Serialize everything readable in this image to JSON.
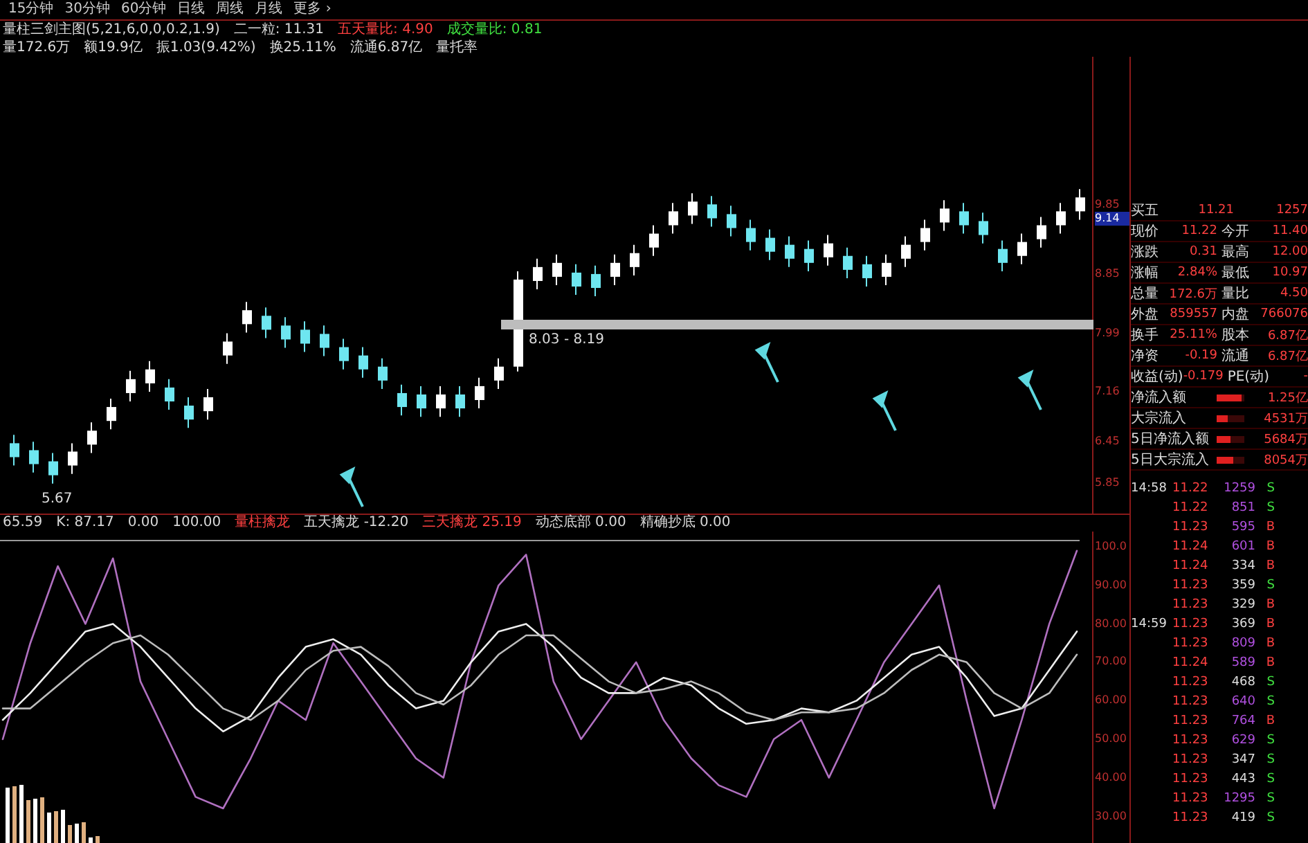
{
  "period_tabs": [
    {
      "label": "15分钟",
      "selected": false
    },
    {
      "label": "30分钟",
      "selected": false
    },
    {
      "label": "60分钟",
      "selected": false
    },
    {
      "label": "日线",
      "selected": false
    },
    {
      "label": "周线",
      "selected": false
    },
    {
      "label": "月线",
      "selected": false
    },
    {
      "label": "更多 ›",
      "selected": false
    }
  ],
  "indicator_header": [
    {
      "text": "量柱三剑主图(5,21,6,0,0,0.2,1.9)",
      "kind": "plain"
    },
    {
      "text": "二一粒: 11.31",
      "kind": "plain"
    },
    {
      "text": "五天量比: 4.90",
      "kind": "red"
    },
    {
      "text": "成交量比: 0.81",
      "kind": "green"
    }
  ],
  "quote_header": [
    "量172.6万",
    "额19.9亿",
    "振1.03(9.42%)",
    "换25.11%",
    "流通6.87亿",
    "量托率"
  ],
  "main_chart": {
    "low_label": "5.67",
    "band_label": "8.03 - 8.19",
    "price_tag": "9.14",
    "chart_data": {
      "type": "candlestick",
      "ylim": [
        5.41,
        11.97
      ],
      "yticks": [
        9.85,
        8.85,
        7.99,
        7.16,
        6.45,
        5.85
      ],
      "ohlc": [
        [
          6.42,
          6.54,
          6.1,
          6.22
        ],
        [
          6.32,
          6.44,
          6.0,
          6.12
        ],
        [
          6.16,
          6.28,
          5.84,
          5.96
        ],
        [
          6.1,
          6.42,
          5.98,
          6.3
        ],
        [
          6.4,
          6.72,
          6.28,
          6.6
        ],
        [
          6.74,
          7.06,
          6.62,
          6.94
        ],
        [
          7.14,
          7.46,
          7.02,
          7.34
        ],
        [
          7.28,
          7.6,
          7.16,
          7.48
        ],
        [
          7.22,
          7.34,
          6.9,
          7.02
        ],
        [
          6.96,
          7.08,
          6.64,
          6.76
        ],
        [
          6.88,
          7.2,
          6.76,
          7.08
        ],
        [
          7.68,
          8.0,
          7.56,
          7.88
        ],
        [
          8.13,
          8.45,
          8.01,
          8.33
        ],
        [
          8.25,
          8.37,
          7.93,
          8.05
        ],
        [
          8.11,
          8.23,
          7.79,
          7.91
        ],
        [
          8.05,
          8.17,
          7.73,
          7.85
        ],
        [
          7.99,
          8.11,
          7.67,
          7.79
        ],
        [
          7.8,
          7.92,
          7.48,
          7.6
        ],
        [
          7.68,
          7.8,
          7.36,
          7.48
        ],
        [
          7.52,
          7.64,
          7.2,
          7.32
        ],
        [
          7.14,
          7.26,
          6.82,
          6.94
        ],
        [
          7.12,
          7.24,
          6.8,
          6.92
        ],
        [
          6.92,
          7.24,
          6.8,
          7.12
        ],
        [
          7.12,
          7.24,
          6.8,
          6.92
        ],
        [
          7.04,
          7.36,
          6.92,
          7.24
        ],
        [
          7.32,
          7.64,
          7.2,
          7.52
        ],
        [
          7.52,
          8.89,
          7.45,
          8.77
        ],
        [
          8.75,
          9.07,
          8.63,
          8.95
        ],
        [
          8.81,
          9.13,
          8.69,
          9.01
        ],
        [
          8.87,
          8.99,
          8.55,
          8.67
        ],
        [
          8.85,
          8.97,
          8.53,
          8.65
        ],
        [
          8.81,
          9.13,
          8.69,
          9.01
        ],
        [
          8.95,
          9.27,
          8.83,
          9.15
        ],
        [
          9.23,
          9.55,
          9.11,
          9.43
        ],
        [
          9.55,
          9.87,
          9.43,
          9.75
        ],
        [
          9.69,
          10.01,
          9.57,
          9.89
        ],
        [
          9.85,
          9.97,
          9.53,
          9.65
        ],
        [
          9.71,
          9.83,
          9.39,
          9.51
        ],
        [
          9.51,
          9.63,
          9.19,
          9.31
        ],
        [
          9.37,
          9.49,
          9.05,
          9.17
        ],
        [
          9.27,
          9.39,
          8.95,
          9.07
        ],
        [
          9.21,
          9.33,
          8.89,
          9.01
        ],
        [
          9.09,
          9.41,
          8.97,
          9.29
        ],
        [
          9.11,
          9.23,
          8.79,
          8.91
        ],
        [
          8.99,
          9.11,
          8.67,
          8.79
        ],
        [
          8.81,
          9.13,
          8.69,
          9.01
        ],
        [
          9.07,
          9.39,
          8.95,
          9.27
        ],
        [
          9.31,
          9.63,
          9.19,
          9.51
        ],
        [
          9.59,
          9.91,
          9.47,
          9.79
        ],
        [
          9.75,
          9.87,
          9.43,
          9.55
        ],
        [
          9.61,
          9.73,
          9.29,
          9.41
        ],
        [
          9.21,
          9.33,
          8.89,
          9.01
        ],
        [
          9.11,
          9.43,
          8.99,
          9.31
        ],
        [
          9.35,
          9.67,
          9.23,
          9.55
        ],
        [
          9.55,
          9.87,
          9.43,
          9.75
        ],
        [
          9.75,
          10.07,
          9.63,
          9.95
        ]
      ]
    }
  },
  "indicator_row": [
    {
      "text": "65.59",
      "kind": "plain"
    },
    {
      "text": "K: 87.17",
      "kind": "plain"
    },
    {
      "text": "0.00",
      "kind": "plain"
    },
    {
      "text": "100.00",
      "kind": "plain"
    },
    {
      "text": "量柱擒龙",
      "kind": "red"
    },
    {
      "text": "五天擒龙 -12.20",
      "kind": "plain"
    },
    {
      "text": "三天擒龙 25.19",
      "kind": "red"
    },
    {
      "text": "动态底部 0.00",
      "kind": "plain"
    },
    {
      "text": "精确抄底 0.00",
      "kind": "plain"
    }
  ],
  "oscillator": {
    "chart_data": {
      "type": "line",
      "ylim": [
        23,
        104
      ],
      "yticks": [
        {
          "value": 100,
          "label": "100.0"
        },
        {
          "value": 90,
          "label": "90.00"
        },
        {
          "value": 80,
          "label": "80.00"
        },
        {
          "value": 70,
          "label": "70.00"
        },
        {
          "value": 60,
          "label": "60.00"
        },
        {
          "value": 50,
          "label": "50.00"
        },
        {
          "value": 40,
          "label": "40.00"
        },
        {
          "value": 30,
          "label": "30.00"
        }
      ],
      "series": [
        {
          "color": "#b070c0",
          "values": [
            50,
            75,
            95,
            80,
            97,
            65,
            50,
            35,
            32,
            45,
            60,
            55,
            75,
            65,
            55,
            45,
            40,
            70,
            90,
            98,
            65,
            50,
            60,
            70,
            55,
            45,
            38,
            35,
            50,
            55,
            40,
            55,
            70,
            80,
            90,
            60,
            32,
            55,
            80,
            99
          ]
        },
        {
          "color": "#eeeeee",
          "values": [
            55,
            62,
            70,
            78,
            80,
            74,
            66,
            58,
            52,
            56,
            66,
            74,
            76,
            72,
            64,
            58,
            60,
            70,
            78,
            80,
            74,
            66,
            62,
            62,
            66,
            64,
            58,
            54,
            55,
            58,
            57,
            60,
            66,
            72,
            74,
            66,
            56,
            58,
            68,
            78
          ]
        },
        {
          "color": "#bdbdbd",
          "values": [
            58,
            58,
            64,
            70,
            75,
            77,
            72,
            65,
            58,
            55,
            60,
            68,
            73,
            74,
            69,
            62,
            59,
            64,
            72,
            77,
            77,
            71,
            65,
            62,
            63,
            65,
            62,
            57,
            55,
            57,
            57,
            58,
            62,
            68,
            72,
            70,
            62,
            58,
            62,
            72
          ]
        }
      ]
    }
  },
  "quote_panel": [
    {
      "l1": "买五",
      "v1": "11.21",
      "v2": "1257"
    },
    {
      "l1": "现价",
      "v1": "11.22",
      "l2": "今开",
      "v2": "11.40"
    },
    {
      "l1": "涨跌",
      "v1": "0.31",
      "l2": "最高",
      "v2": "12.00"
    },
    {
      "l1": "涨幅",
      "v1": "2.84%",
      "l2": "最低",
      "v2": "10.97"
    },
    {
      "l1": "总量",
      "v1": "172.6万",
      "l2": "量比",
      "v2": "4.50"
    },
    {
      "l1": "外盘",
      "v1": "859557",
      "l2": "内盘",
      "v2": "766076"
    },
    {
      "l1": "换手",
      "v1": "25.11%",
      "l2": "股本",
      "v2": "6.87亿"
    },
    {
      "l1": "净资",
      "v1": "-0.19",
      "l2": "流通",
      "v2": "6.87亿"
    },
    {
      "l1": "收益(动)",
      "v1": "-0.179",
      "l2": "PE(动)",
      "v2": "-"
    }
  ],
  "fund_flow": [
    {
      "label": "净流入额",
      "value": "1.25亿",
      "level": 0.9
    },
    {
      "label": "大宗流入",
      "value": "4531万",
      "level": 0.4
    },
    {
      "label": "5日净流入额",
      "value": "5684万",
      "level": 0.5
    },
    {
      "label": "5日大宗流入",
      "value": "8054万",
      "level": 0.6
    }
  ],
  "ticks": [
    {
      "time": "14:58",
      "price": "11.22",
      "volume": "1259",
      "side": "S",
      "kind": "sell",
      "big": true
    },
    {
      "price": "11.22",
      "volume": "851",
      "side": "S",
      "kind": "sell",
      "big": true
    },
    {
      "price": "11.23",
      "volume": "595",
      "side": "B",
      "kind": "buy",
      "big": true
    },
    {
      "price": "11.24",
      "volume": "601",
      "side": "B",
      "kind": "buy",
      "big": true
    },
    {
      "price": "11.24",
      "volume": "334",
      "side": "B",
      "kind": "buy",
      "big": false
    },
    {
      "price": "11.23",
      "volume": "359",
      "side": "S",
      "kind": "sell",
      "big": false
    },
    {
      "price": "11.23",
      "volume": "329",
      "side": "B",
      "kind": "buy",
      "big": false
    },
    {
      "time": "14:59",
      "price": "11.23",
      "volume": "369",
      "side": "B",
      "kind": "buy",
      "big": false
    },
    {
      "price": "11.23",
      "volume": "809",
      "side": "B",
      "kind": "buy",
      "big": true
    },
    {
      "price": "11.24",
      "volume": "589",
      "side": "B",
      "kind": "buy",
      "big": true
    },
    {
      "price": "11.23",
      "volume": "468",
      "side": "S",
      "kind": "sell",
      "big": false
    },
    {
      "price": "11.23",
      "volume": "640",
      "side": "S",
      "kind": "sell",
      "big": true
    },
    {
      "price": "11.23",
      "volume": "764",
      "side": "B",
      "kind": "buy",
      "big": true
    },
    {
      "price": "11.23",
      "volume": "629",
      "side": "S",
      "kind": "sell",
      "big": true
    },
    {
      "price": "11.23",
      "volume": "347",
      "side": "S",
      "kind": "sell",
      "big": false
    },
    {
      "price": "11.23",
      "volume": "443",
      "side": "S",
      "kind": "sell",
      "big": false
    },
    {
      "price": "11.23",
      "volume": "1295",
      "side": "S",
      "kind": "sell",
      "big": true
    },
    {
      "price": "11.23",
      "volume": "419",
      "side": "S",
      "kind": "sell",
      "big": false
    }
  ]
}
